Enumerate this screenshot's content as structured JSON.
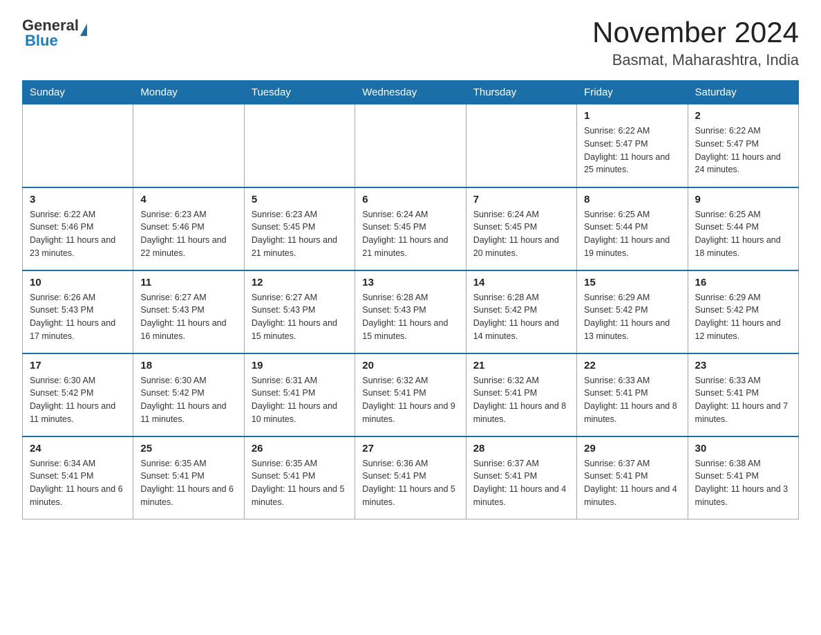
{
  "header": {
    "logo_general": "General",
    "logo_blue": "Blue",
    "month_title": "November 2024",
    "location": "Basmat, Maharashtra, India"
  },
  "weekdays": [
    "Sunday",
    "Monday",
    "Tuesday",
    "Wednesday",
    "Thursday",
    "Friday",
    "Saturday"
  ],
  "weeks": [
    [
      {
        "day": "",
        "sunrise": "",
        "sunset": "",
        "daylight": ""
      },
      {
        "day": "",
        "sunrise": "",
        "sunset": "",
        "daylight": ""
      },
      {
        "day": "",
        "sunrise": "",
        "sunset": "",
        "daylight": ""
      },
      {
        "day": "",
        "sunrise": "",
        "sunset": "",
        "daylight": ""
      },
      {
        "day": "",
        "sunrise": "",
        "sunset": "",
        "daylight": ""
      },
      {
        "day": "1",
        "sunrise": "Sunrise: 6:22 AM",
        "sunset": "Sunset: 5:47 PM",
        "daylight": "Daylight: 11 hours and 25 minutes."
      },
      {
        "day": "2",
        "sunrise": "Sunrise: 6:22 AM",
        "sunset": "Sunset: 5:47 PM",
        "daylight": "Daylight: 11 hours and 24 minutes."
      }
    ],
    [
      {
        "day": "3",
        "sunrise": "Sunrise: 6:22 AM",
        "sunset": "Sunset: 5:46 PM",
        "daylight": "Daylight: 11 hours and 23 minutes."
      },
      {
        "day": "4",
        "sunrise": "Sunrise: 6:23 AM",
        "sunset": "Sunset: 5:46 PM",
        "daylight": "Daylight: 11 hours and 22 minutes."
      },
      {
        "day": "5",
        "sunrise": "Sunrise: 6:23 AM",
        "sunset": "Sunset: 5:45 PM",
        "daylight": "Daylight: 11 hours and 21 minutes."
      },
      {
        "day": "6",
        "sunrise": "Sunrise: 6:24 AM",
        "sunset": "Sunset: 5:45 PM",
        "daylight": "Daylight: 11 hours and 21 minutes."
      },
      {
        "day": "7",
        "sunrise": "Sunrise: 6:24 AM",
        "sunset": "Sunset: 5:45 PM",
        "daylight": "Daylight: 11 hours and 20 minutes."
      },
      {
        "day": "8",
        "sunrise": "Sunrise: 6:25 AM",
        "sunset": "Sunset: 5:44 PM",
        "daylight": "Daylight: 11 hours and 19 minutes."
      },
      {
        "day": "9",
        "sunrise": "Sunrise: 6:25 AM",
        "sunset": "Sunset: 5:44 PM",
        "daylight": "Daylight: 11 hours and 18 minutes."
      }
    ],
    [
      {
        "day": "10",
        "sunrise": "Sunrise: 6:26 AM",
        "sunset": "Sunset: 5:43 PM",
        "daylight": "Daylight: 11 hours and 17 minutes."
      },
      {
        "day": "11",
        "sunrise": "Sunrise: 6:27 AM",
        "sunset": "Sunset: 5:43 PM",
        "daylight": "Daylight: 11 hours and 16 minutes."
      },
      {
        "day": "12",
        "sunrise": "Sunrise: 6:27 AM",
        "sunset": "Sunset: 5:43 PM",
        "daylight": "Daylight: 11 hours and 15 minutes."
      },
      {
        "day": "13",
        "sunrise": "Sunrise: 6:28 AM",
        "sunset": "Sunset: 5:43 PM",
        "daylight": "Daylight: 11 hours and 15 minutes."
      },
      {
        "day": "14",
        "sunrise": "Sunrise: 6:28 AM",
        "sunset": "Sunset: 5:42 PM",
        "daylight": "Daylight: 11 hours and 14 minutes."
      },
      {
        "day": "15",
        "sunrise": "Sunrise: 6:29 AM",
        "sunset": "Sunset: 5:42 PM",
        "daylight": "Daylight: 11 hours and 13 minutes."
      },
      {
        "day": "16",
        "sunrise": "Sunrise: 6:29 AM",
        "sunset": "Sunset: 5:42 PM",
        "daylight": "Daylight: 11 hours and 12 minutes."
      }
    ],
    [
      {
        "day": "17",
        "sunrise": "Sunrise: 6:30 AM",
        "sunset": "Sunset: 5:42 PM",
        "daylight": "Daylight: 11 hours and 11 minutes."
      },
      {
        "day": "18",
        "sunrise": "Sunrise: 6:30 AM",
        "sunset": "Sunset: 5:42 PM",
        "daylight": "Daylight: 11 hours and 11 minutes."
      },
      {
        "day": "19",
        "sunrise": "Sunrise: 6:31 AM",
        "sunset": "Sunset: 5:41 PM",
        "daylight": "Daylight: 11 hours and 10 minutes."
      },
      {
        "day": "20",
        "sunrise": "Sunrise: 6:32 AM",
        "sunset": "Sunset: 5:41 PM",
        "daylight": "Daylight: 11 hours and 9 minutes."
      },
      {
        "day": "21",
        "sunrise": "Sunrise: 6:32 AM",
        "sunset": "Sunset: 5:41 PM",
        "daylight": "Daylight: 11 hours and 8 minutes."
      },
      {
        "day": "22",
        "sunrise": "Sunrise: 6:33 AM",
        "sunset": "Sunset: 5:41 PM",
        "daylight": "Daylight: 11 hours and 8 minutes."
      },
      {
        "day": "23",
        "sunrise": "Sunrise: 6:33 AM",
        "sunset": "Sunset: 5:41 PM",
        "daylight": "Daylight: 11 hours and 7 minutes."
      }
    ],
    [
      {
        "day": "24",
        "sunrise": "Sunrise: 6:34 AM",
        "sunset": "Sunset: 5:41 PM",
        "daylight": "Daylight: 11 hours and 6 minutes."
      },
      {
        "day": "25",
        "sunrise": "Sunrise: 6:35 AM",
        "sunset": "Sunset: 5:41 PM",
        "daylight": "Daylight: 11 hours and 6 minutes."
      },
      {
        "day": "26",
        "sunrise": "Sunrise: 6:35 AM",
        "sunset": "Sunset: 5:41 PM",
        "daylight": "Daylight: 11 hours and 5 minutes."
      },
      {
        "day": "27",
        "sunrise": "Sunrise: 6:36 AM",
        "sunset": "Sunset: 5:41 PM",
        "daylight": "Daylight: 11 hours and 5 minutes."
      },
      {
        "day": "28",
        "sunrise": "Sunrise: 6:37 AM",
        "sunset": "Sunset: 5:41 PM",
        "daylight": "Daylight: 11 hours and 4 minutes."
      },
      {
        "day": "29",
        "sunrise": "Sunrise: 6:37 AM",
        "sunset": "Sunset: 5:41 PM",
        "daylight": "Daylight: 11 hours and 4 minutes."
      },
      {
        "day": "30",
        "sunrise": "Sunrise: 6:38 AM",
        "sunset": "Sunset: 5:41 PM",
        "daylight": "Daylight: 11 hours and 3 minutes."
      }
    ]
  ]
}
